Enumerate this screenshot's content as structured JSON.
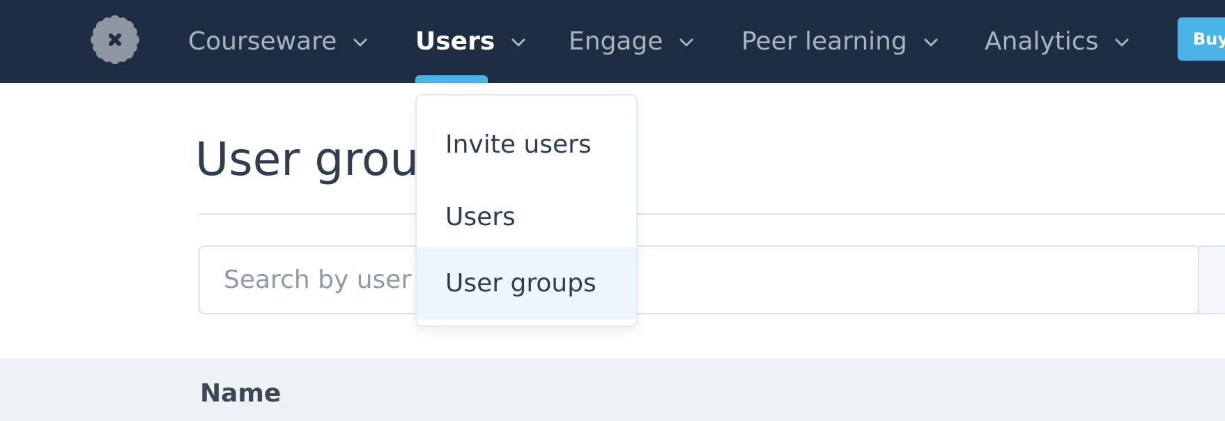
{
  "nav": {
    "items": [
      {
        "label": "Courseware"
      },
      {
        "label": "Users"
      },
      {
        "label": "Engage"
      },
      {
        "label": "Peer learning"
      },
      {
        "label": "Analytics"
      }
    ],
    "active_index": 1,
    "buy_label": "Buy"
  },
  "dropdown": {
    "items": [
      {
        "label": "Invite users"
      },
      {
        "label": "Users"
      },
      {
        "label": "User groups"
      }
    ],
    "selected_index": 2
  },
  "page": {
    "title": "User groups",
    "search_placeholder": "Search by user group name"
  },
  "table": {
    "columns": [
      "Name"
    ]
  },
  "colors": {
    "topbar": "#1f2d42",
    "accent": "#4ab3e8",
    "nav_text": "#a9b4c2",
    "selected_row": "#eef6fd"
  },
  "icons": {
    "logo": "flower-logo-icon",
    "chevron": "chevron-down-icon"
  }
}
